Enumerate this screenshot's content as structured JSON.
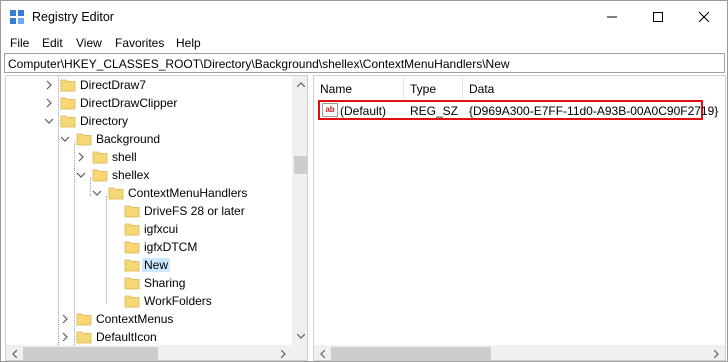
{
  "window": {
    "title": "Registry Editor"
  },
  "menu": [
    "File",
    "Edit",
    "View",
    "Favorites",
    "Help"
  ],
  "address": "Computer\\HKEY_CLASSES_ROOT\\Directory\\Background\\shellex\\ContextMenuHandlers\\New",
  "tree": [
    {
      "label": "DirectDraw7",
      "expander": "collapsed"
    },
    {
      "label": "DirectDrawClipper",
      "expander": "collapsed"
    },
    {
      "label": "Directory",
      "expander": "expanded"
    },
    {
      "label": "Background",
      "expander": "expanded"
    },
    {
      "label": "shell",
      "expander": "collapsed"
    },
    {
      "label": "shellex",
      "expander": "expanded"
    },
    {
      "label": "ContextMenuHandlers",
      "expander": "expanded"
    },
    {
      "label": "DriveFS 28 or later",
      "expander": "none"
    },
    {
      "label": "igfxcui",
      "expander": "none"
    },
    {
      "label": "igfxDTCM",
      "expander": "none"
    },
    {
      "label": "New",
      "expander": "none",
      "selected": true
    },
    {
      "label": "Sharing",
      "expander": "none"
    },
    {
      "label": "WorkFolders",
      "expander": "none"
    },
    {
      "label": "ContextMenus",
      "expander": "collapsed"
    },
    {
      "label": "DefaultIcon",
      "expander": "collapsed"
    }
  ],
  "columns": {
    "name": "Name",
    "type": "Type",
    "data": "Data"
  },
  "values": [
    {
      "icon": "ab",
      "name": "(Default)",
      "type": "REG_SZ",
      "data": "{D969A300-E7FF-11d0-A93B-00A0C90F2719}"
    }
  ],
  "colors": {
    "selection": "#cce8ff",
    "highlight_border": "#e01010",
    "folder": "#f8d775"
  }
}
